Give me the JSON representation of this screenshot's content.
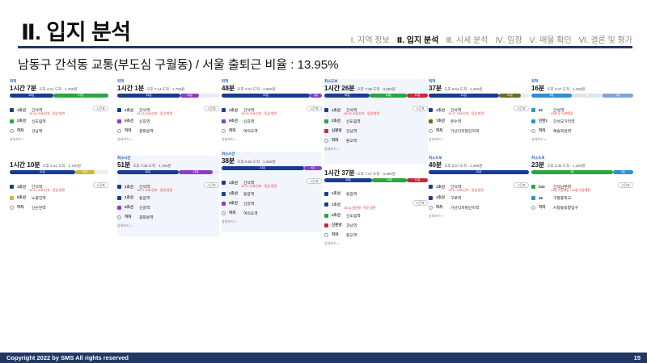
{
  "slide": {
    "title": "Ⅱ. 입지 분석",
    "subtitle": "남동구 간석동 교통(부도심 구월동) / 서울 출퇴근 비율 : 13.95%",
    "nav": [
      "Ⅰ. 지역 정보",
      "Ⅱ. 입지 분석",
      "Ⅲ. 시세 분석",
      "Ⅳ. 임장",
      "Ⅴ. 매물 확인",
      "Ⅵ. 결론 및 평가"
    ],
    "active_nav": 1
  },
  "footer": {
    "copyright": "Copyright 2022 by SMS All rights reserved",
    "page": "15"
  },
  "colors": {
    "navy": "#1f3864",
    "line1": "#1a3c8f",
    "line2": "#2aa53f",
    "line5": "#8a3ec1",
    "line7": "#6b6d1f",
    "shinbundang": "#c9273b",
    "bus": "#2d8fd6",
    "sinbundang": "#d23b4a"
  },
  "panels": [
    {
      "tag": "최적",
      "duration": "1시간 7분",
      "info": "오후 4:21 도착 · 1,750원",
      "segments": [
        {
          "from": 0,
          "to": 44,
          "color": "#1a3c8f",
          "label": "35분"
        },
        {
          "from": 44,
          "to": 100,
          "color": "#2aa53f",
          "label": "27분"
        }
      ],
      "steps": [
        {
          "icon": "#1a3c8f",
          "line": "1호선",
          "station": "간석역",
          "note": "19:14 소요/신호 · 동암 방면",
          "button": "시간표"
        },
        {
          "icon": "#2aa53f",
          "line": "2호선",
          "station": "신도림역",
          "note": "",
          "button": ""
        },
        {
          "icon": "walk",
          "line": "하차",
          "station": "강남역",
          "note": "",
          "button": ""
        }
      ],
      "more": "상세보기 >"
    },
    {
      "tag": "최적",
      "duration": "1시간 1분",
      "info": "오후 7:14 도착 · 1,750원",
      "segments": [
        {
          "from": 0,
          "to": 62,
          "color": "#1a3c8f",
          "label": "45분"
        },
        {
          "from": 62,
          "to": 80,
          "color": "#8a3ec1",
          "label": "19분"
        }
      ],
      "steps": [
        {
          "icon": "#1a3c8f",
          "line": "1호선",
          "station": "간석역",
          "note": "19:13 소요/신호 · 동암 방면",
          "button": "시간표"
        },
        {
          "icon": "#8a3ec1",
          "line": "5호선",
          "station": "신길역",
          "note": "",
          "button": ""
        },
        {
          "icon": "walk",
          "line": "하차",
          "station": "광화문역",
          "note": "",
          "button": ""
        }
      ],
      "more": "상세보기 >"
    },
    {
      "tag": "최적",
      "duration": "48분",
      "info": "오후 7:01 도착 · 1,550원",
      "segments": [
        {
          "from": 0,
          "to": 88,
          "color": "#1a3c8f",
          "label": "44분"
        },
        {
          "from": 88,
          "to": 100,
          "color": "#8a3ec1",
          "label": "4분"
        }
      ],
      "steps": [
        {
          "icon": "#1a3c8f",
          "line": "1호선",
          "station": "간석역",
          "note": "19:13 소요/신호 · 동암 방면",
          "button": "시간표"
        },
        {
          "icon": "#8a3ec1",
          "line": "5호선",
          "station": "신길역",
          "note": "",
          "button": ""
        },
        {
          "icon": "walk",
          "line": "하차",
          "station": "여의도역",
          "note": "",
          "button": ""
        }
      ],
      "more": "상세보기 >"
    },
    {
      "tag": "최소도보",
      "duration": "1시간 26분",
      "info": "오후 7:38 도착 · 3,650원",
      "segments": [
        {
          "from": 0,
          "to": 44,
          "color": "#1a3c8f",
          "label": "35분"
        },
        {
          "from": 44,
          "to": 80,
          "color": "#2aa53f",
          "label": "33분"
        },
        {
          "from": 80,
          "to": 100,
          "color": "#c9273b",
          "label": "11분"
        }
      ],
      "steps": [
        {
          "icon": "#1a3c8f",
          "line": "1호선",
          "station": "간석역",
          "note": "19:13 소요/신호 · 동암 방면",
          "button": "시간표"
        },
        {
          "icon": "#2aa53f",
          "line": "2호선",
          "station": "신도림역",
          "note": "",
          "button": ""
        },
        {
          "icon": "#c9273b",
          "line": "신분당",
          "station": "강남역",
          "note": "",
          "button": ""
        },
        {
          "icon": "walk",
          "line": "하차",
          "station": "판교역",
          "note": "",
          "button": ""
        }
      ],
      "more": "상세보기 >"
    },
    {
      "tag": "최적",
      "duration": "37분",
      "info": "오후 9:54 도착 · 1,450원",
      "segments": [
        {
          "from": 0,
          "to": 70,
          "color": "#1a3c8f",
          "label": "21분"
        },
        {
          "from": 70,
          "to": 92,
          "color": "#6b6d1f",
          "label": "13분"
        }
      ],
      "steps": [
        {
          "icon": "#1a3c8f",
          "line": "1호선",
          "station": "간석역",
          "note": "19:17 소요/신호 · 동암 방면",
          "button": "시간표"
        },
        {
          "icon": "#6b6d1f",
          "line": "7호선",
          "station": "온수역",
          "note": "",
          "button": ""
        },
        {
          "icon": "walk",
          "line": "하차",
          "station": "가산디지털단지역",
          "note": "",
          "button": ""
        }
      ],
      "more": "상세보기 >"
    },
    {
      "tag": "최적",
      "duration": "16분",
      "info": "오후 3:27 도착 · 1,250원",
      "segments": [
        {
          "from": 0,
          "to": 40,
          "color": "#2d8fd6",
          "label": "6분"
        },
        {
          "from": 40,
          "to": 70,
          "color": "#e0e4ec",
          "label": "4분"
        },
        {
          "from": 70,
          "to": 100,
          "color": "#7fa4d9",
          "label": "4분"
        }
      ],
      "steps": [
        {
          "icon": "#2d8fd6",
          "line": "62",
          "station": "간석역",
          "note": "13분 후 도착예정",
          "button": ""
        },
        {
          "icon": "#2d8fd6",
          "line": "인천1",
          "station": "간석오거리역",
          "note": "",
          "button": ""
        },
        {
          "icon": "walk",
          "line": "하차",
          "station": "예술회관역",
          "note": "",
          "button": ""
        }
      ],
      "more": "상세보기 >"
    },
    {
      "tag": "",
      "duration": "1시간 10분",
      "info": "오후 4:32 도착 · 1,750원",
      "segments": [
        {
          "from": 0,
          "to": 66,
          "color": "#1a3c8f",
          "label": "44분"
        },
        {
          "from": 66,
          "to": 86,
          "color": "#c9b830",
          "label": "14분"
        }
      ],
      "steps": [
        {
          "icon": "#1a3c8f",
          "line": "1호선",
          "station": "간석역",
          "note": "19:13 소요/신호 · 동암 방면",
          "button": "시간표"
        },
        {
          "icon": "#c9b830",
          "line": "9호선",
          "station": "노량진역",
          "note": "",
          "button": ""
        },
        {
          "icon": "walk",
          "line": "하차",
          "station": "신논현역",
          "note": "",
          "button": ""
        }
      ],
      "more": ""
    },
    {
      "tag": "최소시간",
      "duration": "51분",
      "info": "오후 7:08 도착 · 1,750원",
      "segments": [
        {
          "from": 0,
          "to": 60,
          "color": "#1a3c8f",
          "label": "38분"
        },
        {
          "from": 60,
          "to": 94,
          "color": "#8a3ec1",
          "label": "13분"
        }
      ],
      "steps": [
        {
          "icon": "#1a3c8f",
          "line": "1호선",
          "station": "간석역",
          "note": "19:17 소요/신호 · 동암 방면",
          "button": "시간표"
        },
        {
          "icon": "#1a3c8f",
          "line": "1호선",
          "station": "동암역",
          "note": "",
          "button": ""
        },
        {
          "icon": "#8a3ec1",
          "line": "5호선",
          "station": "신길역",
          "note": "",
          "button": ""
        },
        {
          "icon": "walk",
          "line": "하차",
          "station": "광화문역",
          "note": "",
          "button": ""
        }
      ],
      "more": "상세보기 >"
    },
    {
      "tag": "최소시간",
      "duration": "38분",
      "info": "오후 6:55 도착 · 1,550원",
      "segments": [
        {
          "from": 0,
          "to": 82,
          "color": "#1a3c8f",
          "label": "33분"
        },
        {
          "from": 82,
          "to": 100,
          "color": "#8a3ec1",
          "label": "4분"
        }
      ],
      "steps": [
        {
          "icon": "#1a3c8f",
          "line": "1호선",
          "station": "간석역",
          "note": "19:17 소요/신호 · 동암 방면",
          "button": "시간표"
        },
        {
          "icon": "#1a3c8f",
          "line": "1호선",
          "station": "동암역",
          "note": "",
          "button": ""
        },
        {
          "icon": "#8a3ec1",
          "line": "5호선",
          "station": "신길역",
          "note": "",
          "button": ""
        },
        {
          "icon": "walk",
          "line": "하차",
          "station": "여의도역",
          "note": "",
          "button": ""
        }
      ],
      "more": "상세보기 >"
    },
    {
      "tag": "",
      "duration": "1시간 37분",
      "info": "오후 7:47 도착 · 3,650원",
      "segments": [
        {
          "from": 0,
          "to": 46,
          "color": "#1a3c8f",
          "label": "38분"
        },
        {
          "from": 46,
          "to": 80,
          "color": "#2aa53f",
          "label": "34분"
        },
        {
          "from": 80,
          "to": 100,
          "color": "#c9273b",
          "label": "11분"
        }
      ],
      "steps": [
        {
          "icon": "#1a3c8f",
          "line": "1호선",
          "station": "동암역",
          "note": "",
          "button": ""
        },
        {
          "icon": "#1a3c8f",
          "line": "1호선",
          "station": "",
          "note": "16:31 환산형 · 백운 방면",
          "button": "시간표"
        },
        {
          "icon": "#2aa53f",
          "line": "2호선",
          "station": "신도림역",
          "note": "",
          "button": ""
        },
        {
          "icon": "#c9273b",
          "line": "신분당",
          "station": "강남역",
          "note": "",
          "button": ""
        },
        {
          "icon": "walk",
          "line": "하차",
          "station": "판교역",
          "note": "",
          "button": ""
        }
      ],
      "more": "상세보기 >"
    },
    {
      "tag": "최소도보",
      "duration": "40분",
      "info": "오후 6:57 도착 · 1,450원",
      "segments": [
        {
          "from": 0,
          "to": 100,
          "color": "#1a3c8f",
          "label": "33분"
        }
      ],
      "steps": [
        {
          "icon": "#1a3c8f",
          "line": "1호선",
          "station": "간석역",
          "note": "19:17 소요/신호 · 동암 방면",
          "button": "시간표"
        },
        {
          "icon": "#1a3c8f",
          "line": "1호선",
          "station": "구로역",
          "note": "",
          "button": ""
        },
        {
          "icon": "walk",
          "line": "하차",
          "station": "가산디지털단지역",
          "note": "",
          "button": ""
        }
      ],
      "more": "상세보기 >"
    },
    {
      "tag": "최소도보",
      "duration": "23분",
      "info": "오후 3:36 도착 · 1,250원",
      "segments": [
        {
          "from": 0,
          "to": 80,
          "color": "#2aa53f",
          "label": "4분"
        },
        {
          "from": 80,
          "to": 100,
          "color": "#2d8fd6",
          "label": "4분"
        }
      ],
      "steps": [
        {
          "icon": "#2aa53f",
          "line": "540",
          "station": "간석남부역",
          "note": "13분 이동예정 · 13분 이동예정",
          "button": "시간표"
        },
        {
          "icon": "#2d8fd6",
          "line": "45",
          "station": "구월중학교",
          "note": "",
          "button": ""
        },
        {
          "icon": "walk",
          "line": "하차",
          "station": "시청동방향입구",
          "note": "",
          "button": ""
        }
      ],
      "more": ""
    }
  ]
}
